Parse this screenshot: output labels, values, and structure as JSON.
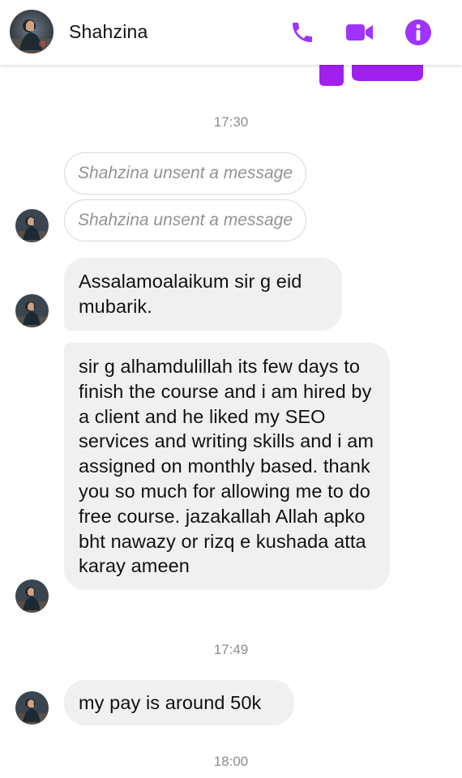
{
  "header": {
    "contact_name": "Shahzina",
    "icons": [
      "phone-icon",
      "video-camera-icon",
      "info-icon"
    ],
    "accent_color": "#a033ff"
  },
  "thread": {
    "timestamp_1": "17:30",
    "unsent_1": "Shahzina unsent a message",
    "unsent_2": "Shahzina unsent a message",
    "message_1": "Assalamoalaikum sir g eid mubarik.",
    "message_2": "sir g alhamdulillah its few days to finish the course and i am hired by a client and he liked my SEO services and writing skills and i am assigned on monthly based. thank you so much for allowing me to do free course. jazakallah Allah apko bht nawazy or rizq e kushada atta karay ameen",
    "timestamp_2": "17:49",
    "message_3": "my pay is around 50k",
    "timestamp_3": "18:00"
  },
  "colors": {
    "bubble_bg": "#f0f0f0",
    "timestamp_text": "#8a8d91",
    "unsent_border": "#d7d9dc"
  }
}
